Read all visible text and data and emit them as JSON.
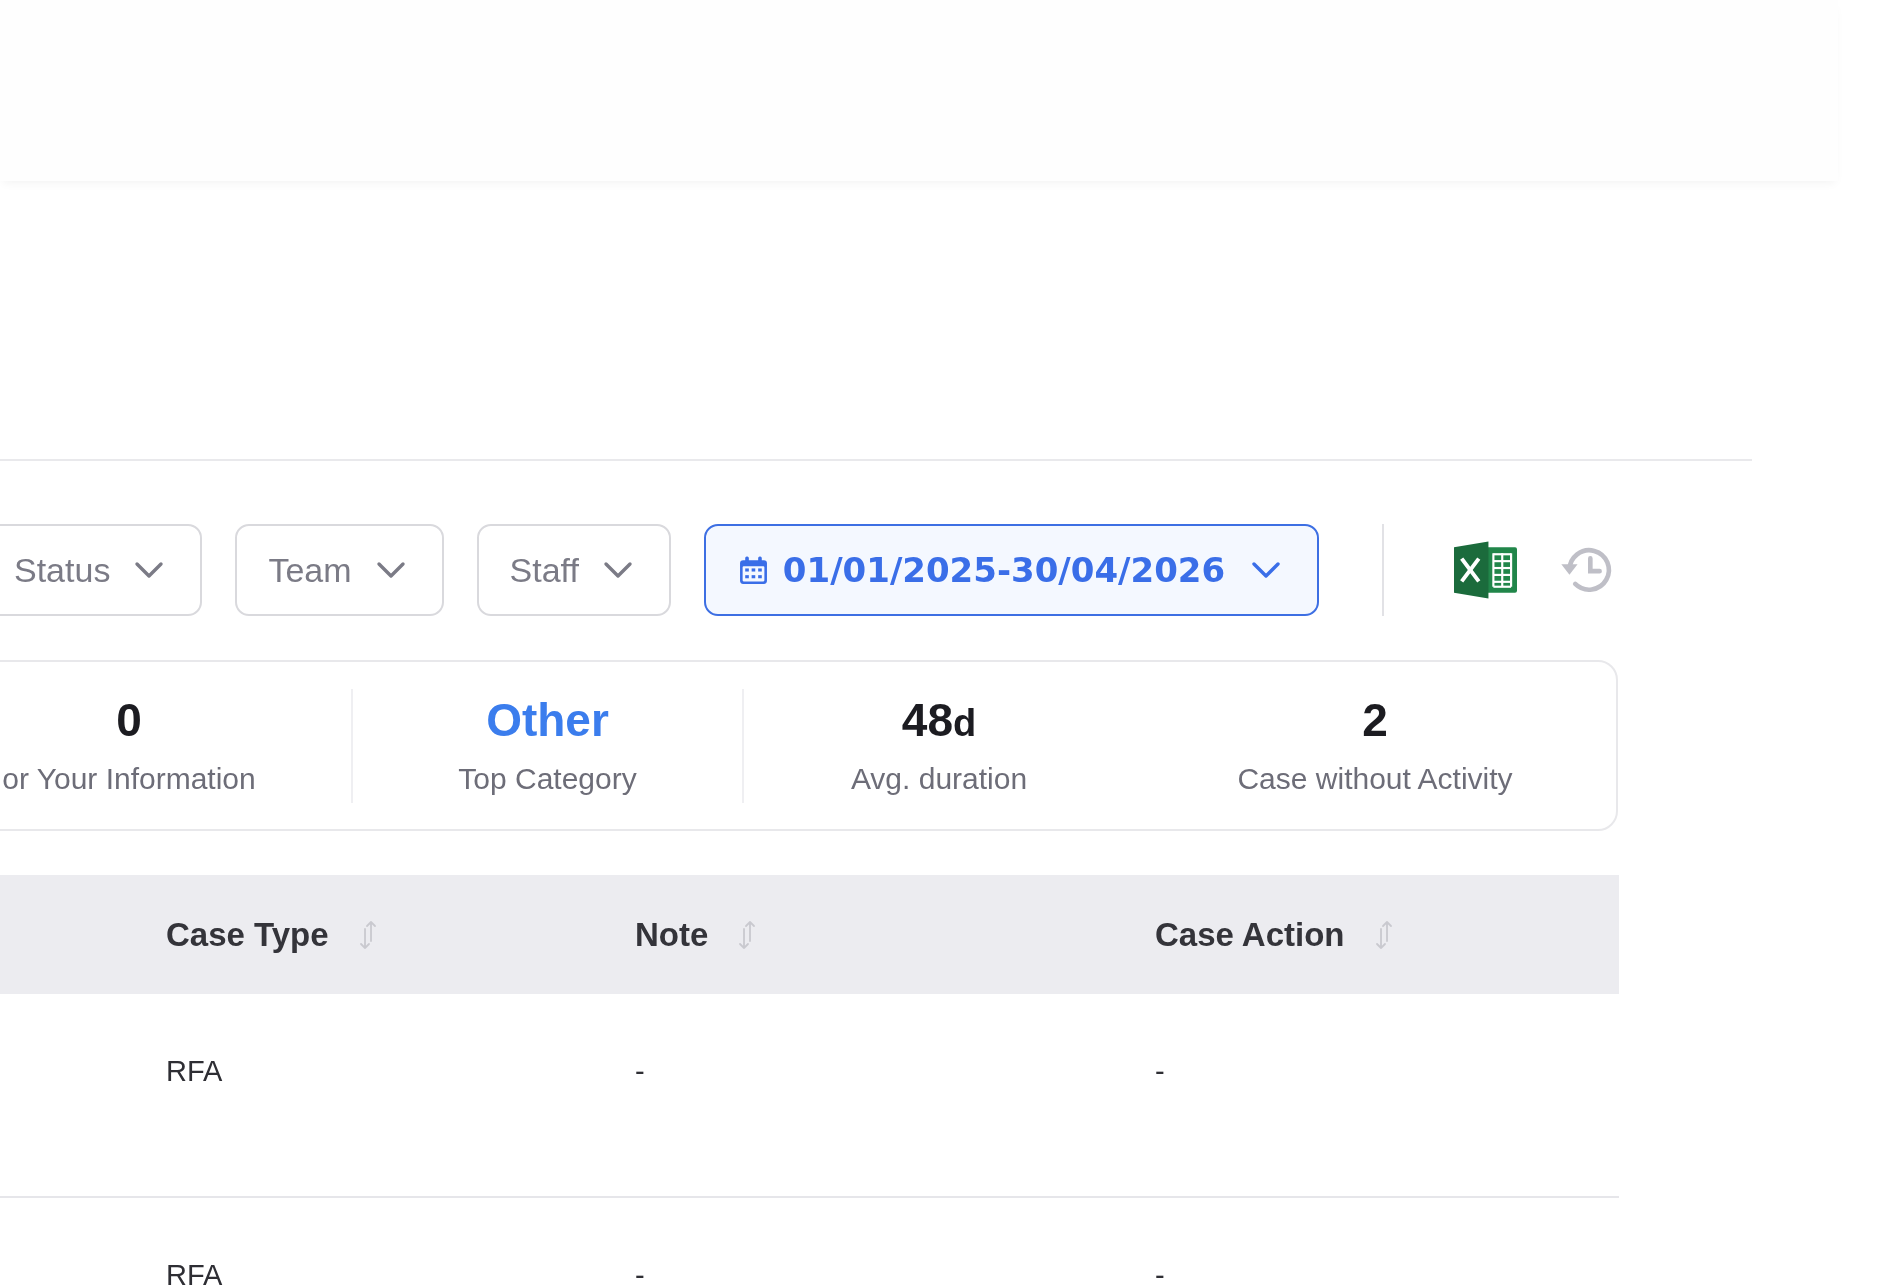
{
  "filters": [
    {
      "kind": "dropdown",
      "label": "Status"
    },
    {
      "kind": "dropdown",
      "label": "Team"
    },
    {
      "kind": "dropdown",
      "label": "Staff"
    },
    {
      "kind": "date_range",
      "label": "01/01/2025-30/04/2026"
    }
  ],
  "stats": [
    {
      "value": "0",
      "label": "or Your Information",
      "color": "#1c1c21",
      "divider": true
    },
    {
      "value": "Other",
      "label": "Top Category",
      "color": "#3b7ded",
      "divider": true
    },
    {
      "value": "48",
      "unit": "d",
      "label": "Avg. duration",
      "color": "#1c1c21",
      "divider": false
    },
    {
      "value": "2",
      "label": "Case without Activity",
      "color": "#1c1c21",
      "divider": false
    }
  ],
  "table": {
    "columns": [
      {
        "label": "Case Type",
        "sortable": true
      },
      {
        "label": "Note",
        "sortable": true
      },
      {
        "label": "Case Action",
        "sortable": true
      }
    ],
    "rows": [
      {
        "cells": [
          "RFA",
          "-",
          "-"
        ]
      },
      {
        "cells": [
          "RFA",
          "-",
          "-"
        ]
      }
    ]
  }
}
